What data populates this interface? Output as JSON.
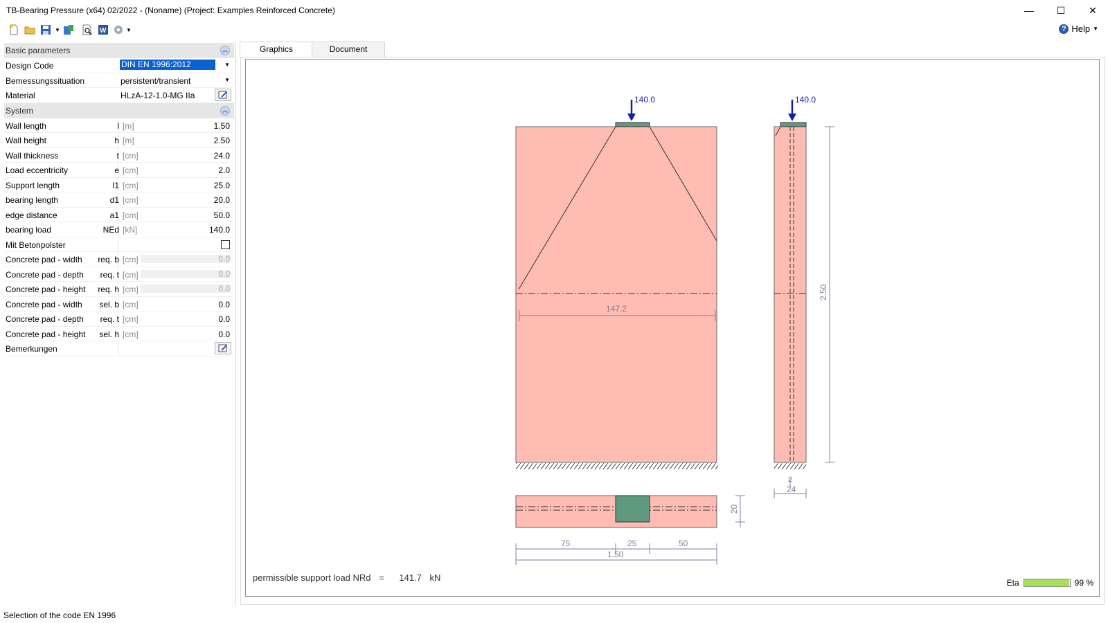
{
  "window": {
    "title": "TB-Bearing Pressure (x64) 02/2022 - (Noname) (Project: Examples Reinforced Concrete)",
    "minimize": "—",
    "maximize": "☐",
    "close": "✕"
  },
  "toolbar": {
    "help_label": "Help",
    "icons": [
      "new-file-icon",
      "open-folder-icon",
      "save-icon",
      "export-icon",
      "print-preview-icon",
      "word-export-icon",
      "settings-icon"
    ]
  },
  "basic": {
    "header": "Basic parameters",
    "design_code_label": "Design Code",
    "design_code_value": "DIN EN 1996:2012",
    "situation_label": "Bemessungssituation",
    "situation_value": "persistent/transient",
    "material_label": "Material",
    "material_value": "HLzA-12-1.0-MG IIa"
  },
  "system": {
    "header": "System",
    "rows": [
      {
        "name": "Wall length",
        "sym": "l",
        "unit": "[m]",
        "val": "1.50"
      },
      {
        "name": "Wall height",
        "sym": "h",
        "unit": "[m]",
        "val": "2.50"
      },
      {
        "name": "Wall thickness",
        "sym": "t",
        "unit": "[cm]",
        "val": "24.0"
      },
      {
        "name": "Load eccentricity",
        "sym": "e",
        "unit": "[cm]",
        "val": "2.0"
      },
      {
        "name": "Support length",
        "sym": "l1",
        "unit": "[cm]",
        "val": "25.0"
      },
      {
        "name": "bearing length",
        "sym": "d1",
        "unit": "[cm]",
        "val": "20.0"
      },
      {
        "name": "edge distance",
        "sym": "a1",
        "unit": "[cm]",
        "val": "50.0"
      },
      {
        "name": "bearing load",
        "sym": "NEd",
        "unit": "[kN]",
        "val": "140.0"
      }
    ],
    "betonpolster_label": "Mit Betonpolster",
    "pad_rows": [
      {
        "name": "Concrete pad - width",
        "sym": "req. b",
        "unit": "[cm]",
        "val": "0.0"
      },
      {
        "name": "Concrete pad - depth",
        "sym": "req. t",
        "unit": "[cm]",
        "val": "0.0"
      },
      {
        "name": "Concrete pad - height",
        "sym": "req. h",
        "unit": "[cm]",
        "val": "0.0"
      },
      {
        "name": "Concrete pad - width",
        "sym": "sel. b",
        "unit": "[cm]",
        "val": "0.0"
      },
      {
        "name": "Concrete pad - depth",
        "sym": "req. t",
        "unit": "[cm]",
        "val": "0.0"
      },
      {
        "name": "Concrete pad - height",
        "sym": "sel. h",
        "unit": "[cm]",
        "val": "0.0"
      }
    ],
    "remarks_label": "Bemerkungen"
  },
  "tabs": [
    "Graphics",
    "Document"
  ],
  "drawing": {
    "load_front": "140.0",
    "load_side": "140.0",
    "width_at_section": "147.2",
    "height_dim": "2.50",
    "thickness_dim": "24",
    "ecc_dim": "2",
    "bearing_depth_dim": "20",
    "dim_left": "75",
    "dim_mid": "25",
    "dim_right": "50",
    "dim_total": "1.50",
    "wall_fill": "#ffbcb3",
    "pad_fill": "#5e9a80",
    "dim_color": "#7f7fa3",
    "load_color": "#1a1aaa"
  },
  "result": {
    "label": "permissible support load  NRd",
    "eq": "=",
    "value": "141.7",
    "unit": "kN"
  },
  "eta": {
    "label": "Eta",
    "value": "99 %",
    "fraction": 0.99,
    "color": "#a8e05a"
  },
  "status": {
    "text": "Selection of the code EN 1996"
  }
}
